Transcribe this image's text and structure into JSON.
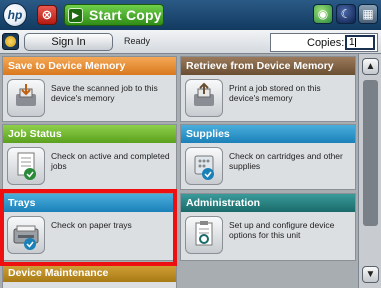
{
  "topbar": {
    "logo_text": "hp",
    "stop_symbol": "⊗",
    "start_label": "Start Copy",
    "start_icon": "▶",
    "icons": [
      "globe-icon",
      "sleep-icon",
      "network-icon"
    ]
  },
  "statusbar": {
    "signin_label": "Sign In",
    "status_text": "Ready",
    "copies_label": "Copies:",
    "copies_value": "1"
  },
  "tiles": [
    {
      "title": "Save to Device Memory",
      "desc": "Save the scanned job to this device's memory",
      "color": "#e88c36"
    },
    {
      "title": "Retrieve from Device Memory",
      "desc": "Print a job stored on this device's memory",
      "color": "#7e6246"
    },
    {
      "title": "Job Status",
      "desc": "Check on active and completed jobs",
      "color": "#72b834"
    },
    {
      "title": "Supplies",
      "desc": "Check on cartridges and other supplies",
      "color": "#2a96c8"
    },
    {
      "title": "Trays",
      "desc": "Check on paper trays",
      "color": "#2a96c8"
    },
    {
      "title": "Administration",
      "desc": "Set up and configure device options for this unit",
      "color": "#2a8282"
    },
    {
      "title": "Device Maintenance",
      "desc": "",
      "color": "#c08e26"
    }
  ],
  "highlight_color": "#ee1010"
}
